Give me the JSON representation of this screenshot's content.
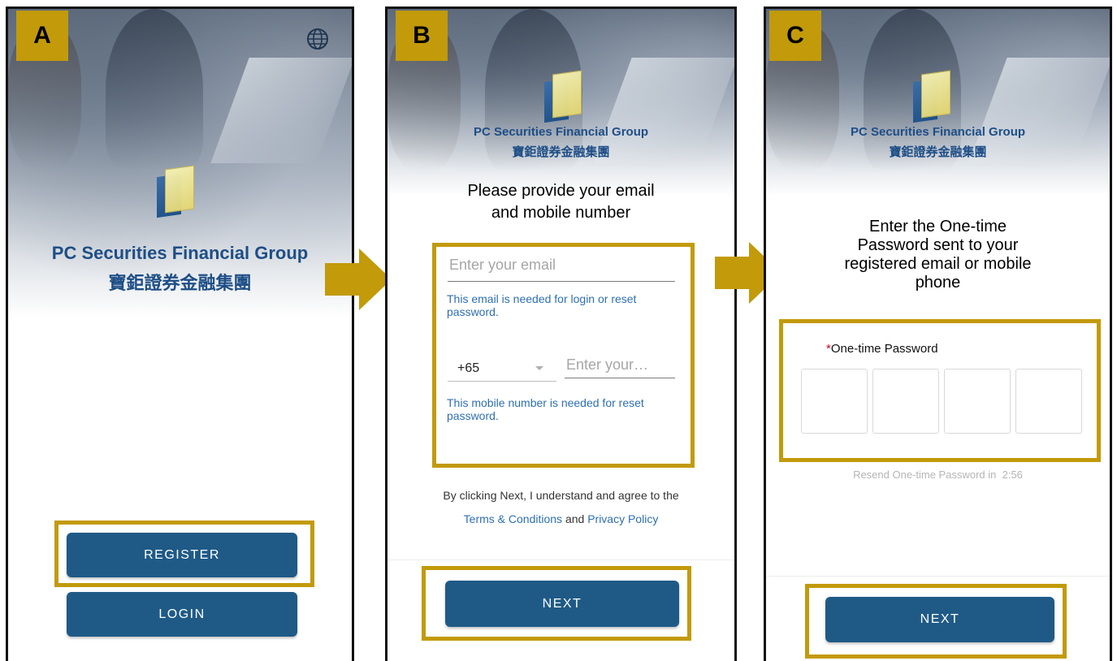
{
  "panels": {
    "a": {
      "label": "A",
      "brand_en": "PC Securities Financial Group",
      "brand_zh": "寶鉅證券金融集團",
      "register_label": "REGISTER",
      "login_label": "LOGIN",
      "globe_icon": "globe-icon"
    },
    "b": {
      "label": "B",
      "brand_en": "PC Securities Financial Group",
      "brand_zh": "寶鉅證券金融集團",
      "heading_line1": "Please provide your email",
      "heading_line2": "and mobile number",
      "email_placeholder": "Enter your email",
      "email_hint": "This email is needed for login or reset password.",
      "country_code": "+65",
      "mobile_placeholder": "Enter your…",
      "mobile_hint": "This mobile number is needed for reset password.",
      "agree_text": "By clicking Next, I understand and agree to the",
      "terms_link": "Terms & Conditions",
      "and_text": "and",
      "privacy_link": "Privacy Policy",
      "next_label": "NEXT"
    },
    "c": {
      "label": "C",
      "brand_en": "PC Securities Financial Group",
      "brand_zh": "寶鉅證券金融集團",
      "heading_line1": "Enter the One-time",
      "heading_line2": "Password sent to your",
      "heading_line3": "registered email or mobile",
      "heading_line4": "phone",
      "required_mark": "*",
      "otp_label": "One-time Password",
      "resend_text": "Resend One-time Password in",
      "resend_timer": "2:56",
      "next_label": "NEXT"
    }
  },
  "colors": {
    "accent_gold": "#c29a0a",
    "button_blue": "#1f5a87",
    "brand_blue": "#1e4e86",
    "link_blue": "#2e6fb3"
  }
}
